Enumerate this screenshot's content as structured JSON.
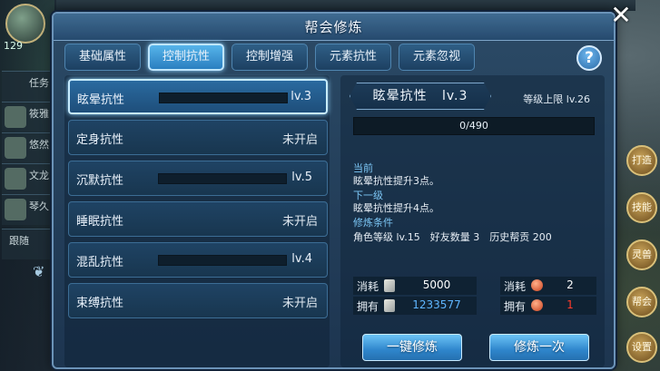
{
  "background": {
    "player_level": "129",
    "side_items": [
      "任务",
      "筱雅",
      "悠然",
      "文龙",
      "琴久"
    ],
    "side_button": "跟随",
    "right_buttons": [
      "打造",
      "技能",
      "灵兽",
      "帮会",
      "设置"
    ]
  },
  "dialog": {
    "title": "帮会修炼",
    "close_glyph": "✕"
  },
  "tabs": [
    {
      "label": "基础属性"
    },
    {
      "label": "控制抗性"
    },
    {
      "label": "控制增强"
    },
    {
      "label": "元素抗性"
    },
    {
      "label": "元素忽视"
    }
  ],
  "help_glyph": "?",
  "resistances": [
    {
      "name": "眩晕抗性",
      "level": "lv.3",
      "locked": ""
    },
    {
      "name": "定身抗性",
      "level": "",
      "locked": "未开启"
    },
    {
      "name": "沉默抗性",
      "level": "lv.5",
      "locked": ""
    },
    {
      "name": "睡眠抗性",
      "level": "",
      "locked": "未开启"
    },
    {
      "name": "混乱抗性",
      "level": "lv.4",
      "locked": ""
    },
    {
      "name": "束缚抗性",
      "level": "",
      "locked": "未开启"
    }
  ],
  "detail": {
    "name": "眩晕抗性",
    "level": "lv.3",
    "cap": "等级上限 lv.26",
    "progress_text": "0/490",
    "progress_fraction": 0,
    "current_head": "当前",
    "current_text": "眩晕抗性提升3点。",
    "next_head": "下一级",
    "next_text": "眩晕抗性提升4点。",
    "cond_head": "修炼条件",
    "cond_text": "角色等级 lv.15　好友数量 3　历史帮贡 200",
    "cost_label": "消耗",
    "own_label": "拥有",
    "cost1": "5000",
    "own1": "1233577",
    "cost2": "2",
    "own2": "1",
    "btn_auto": "一键修炼",
    "btn_once": "修炼一次"
  },
  "colors": {
    "accent": "#56b4ea",
    "owned_blue": "#5fb6ff",
    "insufficient_red": "#ff3a2a",
    "section_head": "#7cc6f5"
  }
}
